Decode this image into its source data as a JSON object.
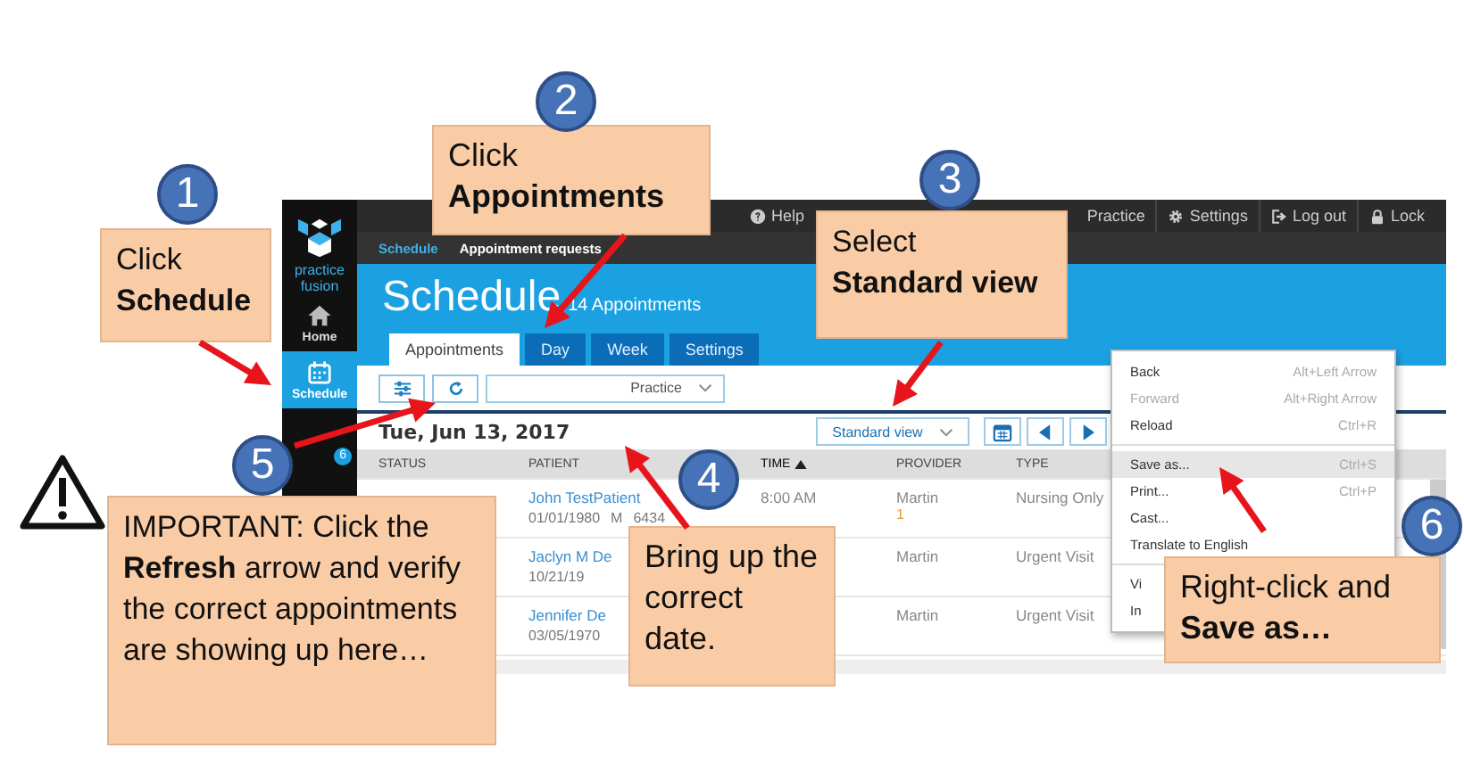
{
  "app": {
    "logo_text": "practice fusion",
    "sidebar": [
      {
        "kind": "home",
        "label": "Home",
        "selected": false
      },
      {
        "kind": "calendar",
        "label": "Schedule",
        "selected": true
      },
      {
        "kind": "badge",
        "badge": "6",
        "selected": false
      }
    ],
    "top_menu": [
      {
        "kind": "help",
        "label": "Help"
      },
      {
        "kind": "plain",
        "label": "Practice"
      },
      {
        "kind": "gear",
        "label": "Settings"
      },
      {
        "kind": "logout",
        "label": "Log out"
      },
      {
        "kind": "lock",
        "label": "Lock"
      }
    ],
    "subnav": [
      {
        "label": "Schedule",
        "selected": true
      },
      {
        "label": "Appointment requests",
        "selected": false
      }
    ],
    "page_title": "Schedule",
    "appointment_count": "14 Appointments",
    "tabs": [
      {
        "label": "Appointments",
        "selected": true
      },
      {
        "label": "Day",
        "selected": false
      },
      {
        "label": "Week",
        "selected": false
      },
      {
        "label": "Settings",
        "selected": false
      }
    ],
    "practice_select": "Practice",
    "date": "Tue, Jun 13, 2017",
    "view_select": "Standard view",
    "table": {
      "columns": [
        {
          "label": "STATUS",
          "sorted": false
        },
        {
          "label": "PATIENT",
          "sorted": false
        },
        {
          "label": "TIME",
          "sorted": true
        },
        {
          "label": "PROVIDER",
          "sorted": false
        },
        {
          "label": "TYPE",
          "sorted": false
        }
      ],
      "rows": [
        {
          "patient": "John TestPatient",
          "details": [
            "01/01/1980",
            "M",
            "6434"
          ],
          "time": "8:00 AM",
          "provider": "Martin",
          "provider_note": "1",
          "type": "Nursing Only"
        },
        {
          "patient": "Jaclyn M De",
          "details": [
            "10/21/19"
          ],
          "provider": "Martin",
          "type": "Urgent Visit"
        },
        {
          "patient": "Jennifer De",
          "details": [
            "03/05/1970"
          ],
          "provider": "Martin",
          "type": "Urgent Visit"
        }
      ]
    },
    "context_menu": [
      [
        {
          "label": "Back",
          "shortcut": "Alt+Left Arrow",
          "disabled": false,
          "selected": false
        },
        {
          "label": "Forward",
          "shortcut": "Alt+Right Arrow",
          "disabled": true,
          "selected": false
        },
        {
          "label": "Reload",
          "shortcut": "Ctrl+R",
          "disabled": false,
          "selected": false
        }
      ],
      [
        {
          "label": "Save as...",
          "shortcut": "Ctrl+S",
          "disabled": false,
          "selected": true
        },
        {
          "label": "Print...",
          "shortcut": "Ctrl+P",
          "disabled": false,
          "selected": false
        },
        {
          "label": "Cast...",
          "disabled": false,
          "selected": false
        },
        {
          "label": "Translate to English",
          "disabled": false,
          "selected": false
        }
      ],
      [
        {
          "label": "Vi",
          "disabled": false,
          "selected": false
        },
        {
          "label": "In",
          "disabled": false,
          "selected": false
        }
      ]
    ]
  },
  "callouts": [
    {
      "number": "1",
      "text": "Click\n**Schedule**"
    },
    {
      "number": "2",
      "text": "Click\n**Appointments**"
    },
    {
      "number": "3",
      "text": "Select\n**Standard view**"
    },
    {
      "number": "5",
      "text": "IMPORTANT: Click the **Refresh** arrow and verify the correct appointments are showing up here…"
    },
    {
      "number": "4",
      "text": "Bring up the correct date."
    },
    {
      "number": "6",
      "text": "Right-click and\n**Save as…**"
    }
  ]
}
